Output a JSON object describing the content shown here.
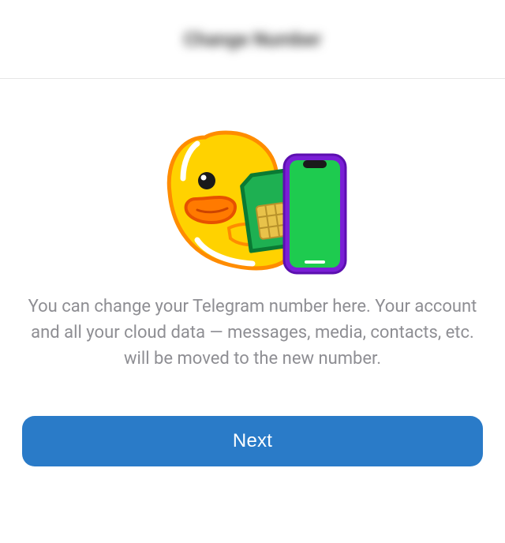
{
  "header": {
    "title": "Change Number"
  },
  "main": {
    "illustration_name": "duck-sim-phone-illustration",
    "description": "You can change your Telegram number here. Your account and all your cloud data — messages, media, contacts, etc. will be moved to the new number.",
    "next_label": "Next"
  },
  "colors": {
    "primary_button": "#2a7bc8",
    "text_secondary": "#8e8e93"
  }
}
